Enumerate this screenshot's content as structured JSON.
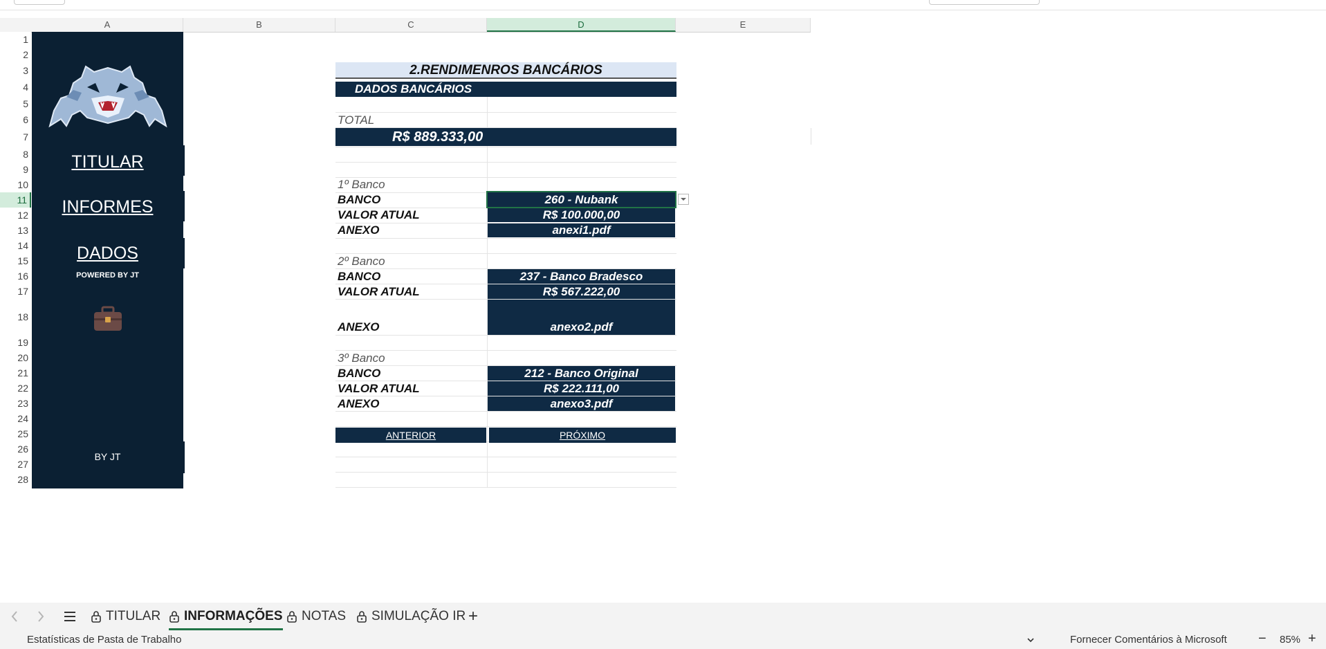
{
  "columns": [
    "A",
    "B",
    "C",
    "D",
    "E"
  ],
  "selected_column": "D",
  "rows": [
    "1",
    "2",
    "3",
    "4",
    "5",
    "6",
    "7",
    "8",
    "9",
    "10",
    "11",
    "12",
    "13",
    "14",
    "15",
    "16",
    "17",
    "18",
    "19",
    "20",
    "21",
    "22",
    "23",
    "24",
    "25",
    "26",
    "27",
    "28"
  ],
  "selected_row": "11",
  "sidebar": {
    "nav": [
      "TITULAR",
      "INFORMES",
      "DADOS"
    ],
    "powered": "POWERED BY JT",
    "footer": "BY JT",
    "logo_icon": "tiger-logo",
    "briefcase_icon": "briefcase-icon",
    "bg_color": "#0b2033"
  },
  "sheet": {
    "title": "2.RENDIMENROS BANCÁRIOS",
    "subtitle": "DADOS BANCÁRIOS",
    "total_label": "TOTAL",
    "total_value": "R$ 889.333,00",
    "banks": [
      {
        "heading": "1º Banco",
        "banco_label": "BANCO",
        "banco": "260 - Nubank",
        "valor_label": "VALOR ATUAL",
        "valor": "R$ 100.000,00",
        "anexo_label": "ANEXO",
        "anexo": "anexi1.pdf"
      },
      {
        "heading": "2º Banco",
        "banco_label": "BANCO",
        "banco": "237 - Banco Bradesco",
        "valor_label": "VALOR ATUAL",
        "valor": "R$ 567.222,00",
        "anexo_label": "ANEXO",
        "anexo": "anexo2.pdf"
      },
      {
        "heading": "3º Banco",
        "banco_label": "BANCO",
        "banco": "212 - Banco Original",
        "valor_label": "VALOR ATUAL",
        "valor": "R$ 222.111,00",
        "anexo_label": "ANEXO",
        "anexo": "anexo3.pdf"
      }
    ],
    "prev_button": "ANTERIOR",
    "next_button": "PRÓXIMO",
    "dark_color": "#0f2a44",
    "title_bg": "#dce6f4"
  },
  "tabs": {
    "items": [
      "TITULAR",
      "INFORMAÇÕES",
      "NOTAS",
      "SIMULAÇÃO IR"
    ],
    "active": "INFORMAÇÕES",
    "add": "+"
  },
  "status": {
    "left": "Estatísticas de Pasta de Trabalho",
    "feedback": "Fornecer Comentários à Microsoft",
    "zoom": "85%",
    "minus": "−",
    "plus": "+"
  }
}
